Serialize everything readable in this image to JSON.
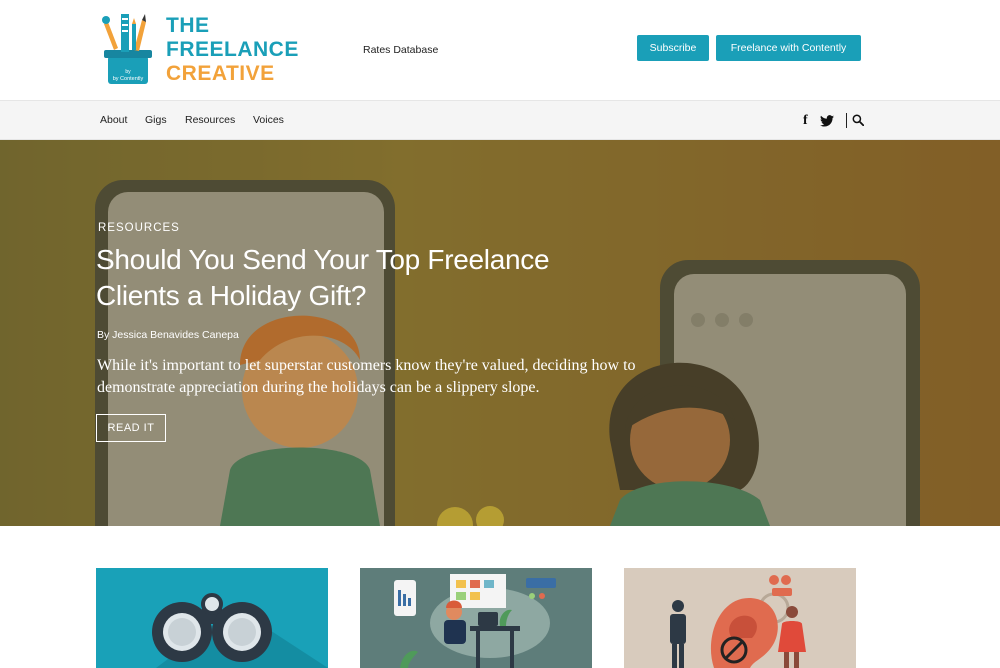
{
  "header": {
    "logo": {
      "line1": "THE",
      "line2": "FREELANCE",
      "line3": "CREATIVE",
      "badge": "by Contently"
    },
    "rates_link": "Rates Database",
    "subscribe_label": "Subscribe",
    "contently_label": "Freelance with Contently"
  },
  "nav": {
    "items": [
      {
        "label": "About"
      },
      {
        "label": "Gigs"
      },
      {
        "label": "Resources"
      },
      {
        "label": "Voices"
      }
    ],
    "social": {
      "facebook": "f",
      "twitter_icon": "twitter-icon"
    },
    "search_icon": "search-icon"
  },
  "hero": {
    "category": "RESOURCES",
    "title": "Should You Send Your Top Freelance Clients a Holiday Gift?",
    "byline": "By Jessica Benavides Canepa",
    "excerpt": "While it's important to let superstar customers know they're valued, deciding how to demonstrate appreciation during the holidays can be a slippery slope.",
    "cta": "READ IT"
  },
  "colors": {
    "brand_teal": "#1a9fb8",
    "brand_orange": "#f2a23a",
    "nav_bg": "#f5f5f5"
  },
  "cards": [
    {
      "image": "binoculars-illustration"
    },
    {
      "image": "remote-worker-desk-illustration"
    },
    {
      "image": "ear-megaphone-illustration"
    }
  ]
}
